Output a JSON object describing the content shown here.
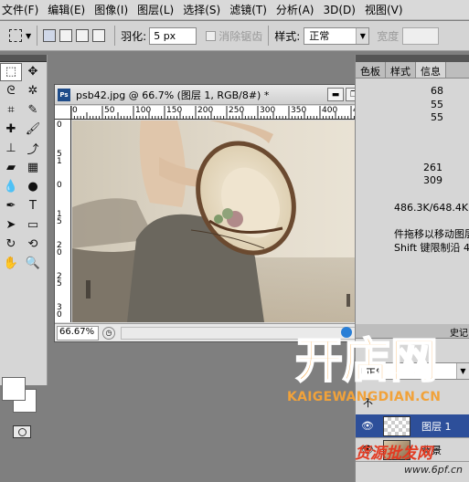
{
  "menu": {
    "items": [
      "文件(F)",
      "编辑(E)",
      "图像(I)",
      "图层(L)",
      "选择(S)",
      "滤镜(T)",
      "分析(A)",
      "3D(D)",
      "视图(V)"
    ]
  },
  "options": {
    "feather_label": "羽化:",
    "feather_value": "5 px",
    "antialias_label": "消除锯齿",
    "style_label": "样式:",
    "style_value": "正常",
    "width_label": "宽度"
  },
  "document": {
    "badge": "Ps",
    "title": "psb42.jpg @ 66.7% (图层 1, RGB/8#) *",
    "zoom": "66.67%",
    "ruler_h": [
      "0",
      "50",
      "100",
      "150",
      "200",
      "250",
      "300",
      "350",
      "400",
      "450"
    ],
    "ruler_v": [
      "0",
      "5",
      "1",
      "0",
      "1",
      "5",
      "2",
      "0",
      "2",
      "5",
      "3",
      "0"
    ]
  },
  "panel": {
    "tabs": [
      "色板",
      "样式",
      "信息"
    ],
    "info": {
      "v1": "68",
      "v2": "55",
      "v3": "55",
      "v4": "261",
      "v5": "309",
      "doc_size": "486.3K/648.4K",
      "hint1": "件拖移以移动图层",
      "hint2": "Shift 键限制沿 4"
    }
  },
  "layers": {
    "tab_partial": "史记",
    "blend_mode": "正常",
    "opacity_partial": "不",
    "rows": [
      {
        "name": "图层 1"
      },
      {
        "name": "背景"
      }
    ]
  },
  "watermark": {
    "logo_text": "开店网",
    "site": "KAIGEWANGDIAN.CN",
    "bottom": "货源批发网",
    "url": "www.6pf.cn"
  }
}
